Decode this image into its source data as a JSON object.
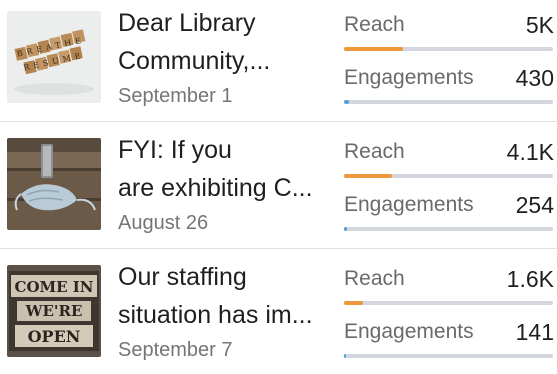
{
  "posts": [
    {
      "thumb_icon": "scrabble-tiles-breathe-resume-icon",
      "title_line1": "Dear Library",
      "title_line2": "Community,...",
      "date": "September 1",
      "reach": {
        "label": "Reach",
        "value": "5K",
        "fill_fraction": 0.28
      },
      "engagements": {
        "label": "Engagements",
        "value": "430",
        "fill_fraction": 0.025
      }
    },
    {
      "thumb_icon": "face-mask-on-table-icon",
      "title_line1": "FYI: If you",
      "title_line2": "are exhibiting C...",
      "date": "August 26",
      "reach": {
        "label": "Reach",
        "value": "4.1K",
        "fill_fraction": 0.23
      },
      "engagements": {
        "label": "Engagements",
        "value": "254",
        "fill_fraction": 0.015
      }
    },
    {
      "thumb_icon": "come-in-were-open-sign-icon",
      "title_line1": "Our staffing",
      "title_line2": "situation has im...",
      "date": "September 7",
      "reach": {
        "label": "Reach",
        "value": "1.6K",
        "fill_fraction": 0.09
      },
      "engagements": {
        "label": "Engagements",
        "value": "141",
        "fill_fraction": 0.01
      }
    }
  ],
  "thumb_text": {
    "tiles_row1": "BREATHE",
    "tiles_row2": "RESUME",
    "sign_line1": "COME IN",
    "sign_line2": "WE'RE",
    "sign_line3": "OPEN"
  },
  "colors": {
    "reach_bar": "#f0963d",
    "engagement_bar": "#4fa3e0",
    "track": "#d4d6de"
  }
}
